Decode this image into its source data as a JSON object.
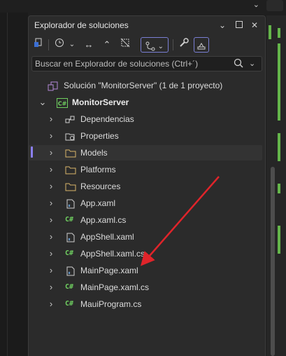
{
  "panel": {
    "title": "Explorador de soluciones"
  },
  "search": {
    "placeholder": "Buscar en Explorador de soluciones (Ctrl+´)"
  },
  "tree": {
    "solution": "Solución \"MonitorServer\"  (1 de 1 proyecto)",
    "project": "MonitorServer",
    "items": [
      {
        "label": "Dependencias",
        "icon": "dependencies-icon"
      },
      {
        "label": "Properties",
        "icon": "properties-icon"
      },
      {
        "label": "Models",
        "icon": "folder-icon",
        "selected": true
      },
      {
        "label": "Platforms",
        "icon": "folder-icon"
      },
      {
        "label": "Resources",
        "icon": "folder-icon"
      },
      {
        "label": "App.xaml",
        "icon": "xaml-file-icon"
      },
      {
        "label": "App.xaml.cs",
        "icon": "csharp-file-icon"
      },
      {
        "label": "AppShell.xaml",
        "icon": "xaml-file-icon"
      },
      {
        "label": "AppShell.xaml.cs",
        "icon": "csharp-file-icon"
      },
      {
        "label": "MainPage.xaml",
        "icon": "xaml-file-icon"
      },
      {
        "label": "MainPage.xaml.cs",
        "icon": "csharp-file-icon"
      },
      {
        "label": "MauiProgram.cs",
        "icon": "csharp-file-icon"
      }
    ]
  },
  "icons": {
    "csharp": "C#"
  },
  "colors": {
    "accent": "#7a7fd4",
    "annotation_arrow": "#e0242a",
    "csharp": "#6fcf60",
    "folder": "#d8b56a"
  }
}
